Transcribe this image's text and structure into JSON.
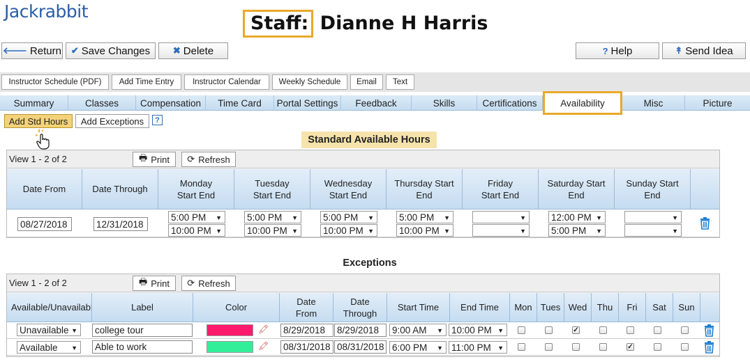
{
  "app": {
    "logo": "Jackrabbit"
  },
  "header": {
    "label": "Staff:",
    "name": "Dianne H Harris"
  },
  "actions": {
    "return": "Return",
    "save": "Save Changes",
    "delete": "Delete",
    "help": "Help",
    "send_idea": "Send Idea"
  },
  "toolbar": [
    "Instructor Schedule (PDF)",
    "Add Time Entry",
    "Instructor Calendar",
    "Weekly Schedule",
    "Email",
    "Text"
  ],
  "tabs": [
    "Summary",
    "Classes",
    "Compensation",
    "Time Card",
    "Portal Settings",
    "Feedback",
    "Skills",
    "Certifications",
    "Availability",
    "Misc",
    "Picture"
  ],
  "active_tab": "Availability",
  "subtoolbar": {
    "add_std": "Add Std Hours",
    "add_exc": "Add Exceptions",
    "help": "?"
  },
  "standard": {
    "title": "Standard Available Hours",
    "view": "View 1 - 2 of 2",
    "print": "Print",
    "refresh": "Refresh",
    "columns": [
      "Date From",
      "Date Through",
      "Monday Start End",
      "Tuesday Start End",
      "Wednesday Start End",
      "Thursday Start End",
      "Friday Start End",
      "Saturday Start End",
      "Sunday Start End"
    ],
    "row": {
      "date_from": "08/27/2018",
      "date_through": "12/31/2018",
      "mon": [
        "5:00 PM",
        "10:00 PM"
      ],
      "tue": [
        "5:00 PM",
        "10:00 PM"
      ],
      "wed": [
        "5:00 PM",
        "10:00 PM"
      ],
      "thu": [
        "5:00 PM",
        "10:00 PM"
      ],
      "fri": [
        "",
        ""
      ],
      "sat": [
        "12:00 PM",
        "5:00 PM"
      ],
      "sun": [
        "",
        ""
      ]
    }
  },
  "exceptions": {
    "title": "Exceptions",
    "view": "View 1 - 2 of 2",
    "print": "Print",
    "refresh": "Refresh",
    "columns": [
      "Available/Unavailable",
      "Label",
      "Color",
      "Date From",
      "Date Through",
      "Start Time",
      "End Time",
      "Mon",
      "Tues",
      "Wed",
      "Thu",
      "Fri",
      "Sat",
      "Sun"
    ],
    "rows": [
      {
        "status": "Unavailable",
        "label": "college tour",
        "color": "#ff1a6e",
        "from": "8/29/2018",
        "through": "8/29/2018",
        "start": "9:00 AM",
        "end": "10:00 PM",
        "days": [
          false,
          false,
          true,
          false,
          false,
          false,
          false
        ]
      },
      {
        "status": "Available",
        "label": "Able to work",
        "color": "#33ee99",
        "from": "08/31/2018",
        "through": "08/31/2018",
        "start": "6:00 PM",
        "end": "11:00 PM",
        "days": [
          false,
          false,
          false,
          false,
          true,
          false,
          false
        ]
      }
    ]
  }
}
